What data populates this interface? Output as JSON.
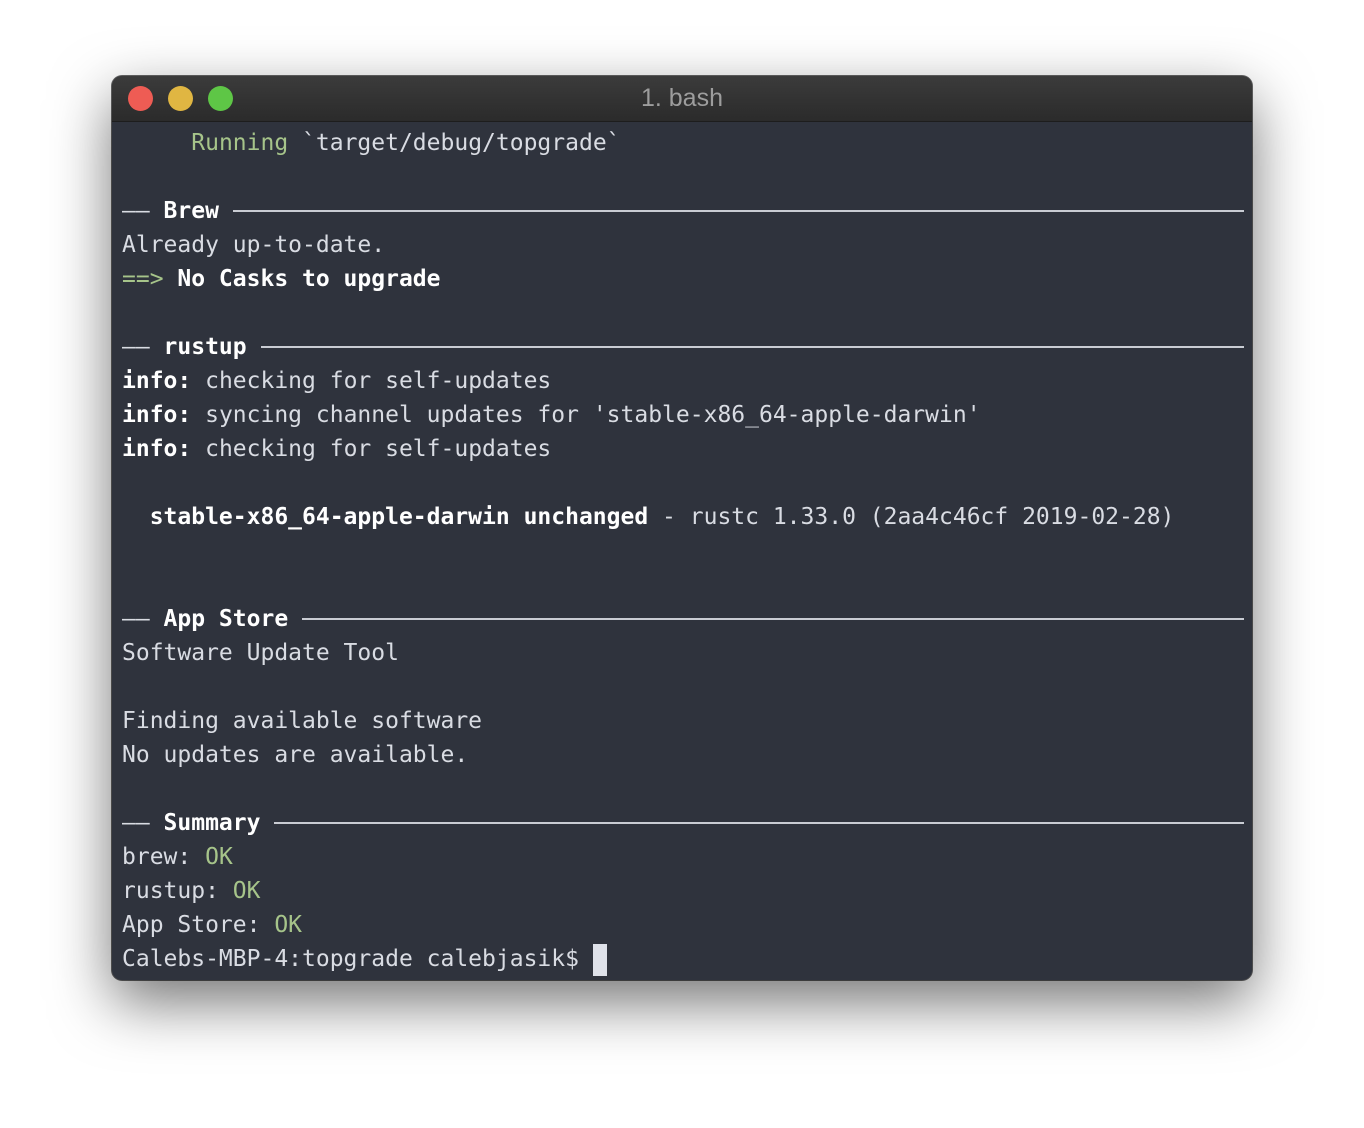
{
  "window": {
    "title": "1. bash",
    "buttons": {
      "close_color": "#ee5c54",
      "minimize_color": "#e0b642",
      "zoom_color": "#5ec646"
    }
  },
  "colors": {
    "background": "#2f333d",
    "text": "#d9dce3",
    "green": "#a6c48a",
    "bold": "#ffffff",
    "cursor": "#dfe2ea"
  },
  "terminal": {
    "running": {
      "indent": "     ",
      "label": "Running",
      "path": " `target/debug/topgrade`"
    },
    "brew": {
      "header_prefix": "―― ",
      "header": "Brew",
      "line1": "Already up-to-date.",
      "arrow": "==>",
      "line2": " No Casks to upgrade"
    },
    "rustup": {
      "header_prefix": "―― ",
      "header": "rustup",
      "info_label": "info:",
      "line1": " checking for self-updates",
      "line2": " syncing channel updates for 'stable-x86_64-apple-darwin'",
      "line3": " checking for self-updates",
      "toolchain": "  stable-x86_64-apple-darwin unchanged",
      "toolchain_rest": " - rustc 1.33.0 (2aa4c46cf 2019-02-28)"
    },
    "appstore": {
      "header_prefix": "―― ",
      "header": "App Store",
      "line1": "Software Update Tool",
      "line2": "Finding available software",
      "line3": "No updates are available."
    },
    "summary": {
      "header_prefix": "―― ",
      "header": "Summary",
      "items": [
        {
          "name": "brew: ",
          "status": "OK"
        },
        {
          "name": "rustup: ",
          "status": "OK"
        },
        {
          "name": "App Store: ",
          "status": "OK"
        }
      ]
    },
    "prompt": "Calebs-MBP-4:topgrade calebjasik$"
  }
}
